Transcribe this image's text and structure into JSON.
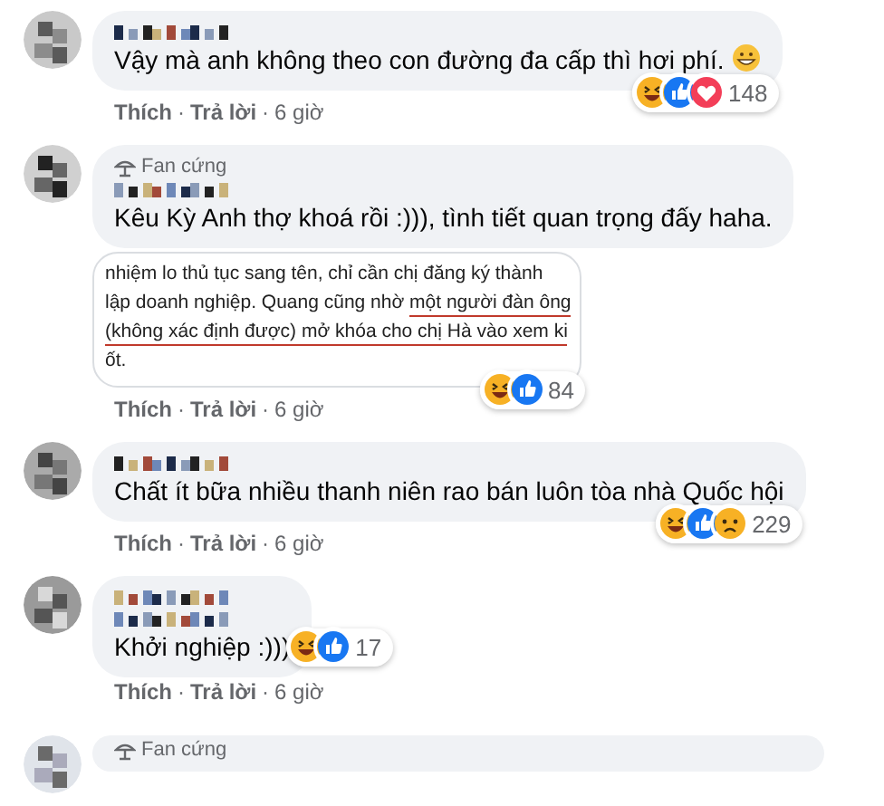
{
  "comments": [
    {
      "text": "Vậy mà anh không theo con đường đa cấp thì hơi phí.",
      "emoji": {
        "kind": "grin"
      },
      "reactions": [
        {
          "kind": "haha"
        },
        {
          "kind": "like"
        },
        {
          "kind": "love"
        }
      ],
      "reaction_count": "148",
      "reactions_inline": false,
      "actions": [
        {
          "kind": "link",
          "text": "Thích"
        },
        {
          "kind": "separator",
          "text": "·"
        },
        {
          "kind": "link",
          "text": "Trả lời"
        },
        {
          "kind": "separator",
          "text": "·"
        },
        {
          "kind": "time",
          "text": "6 giờ"
        }
      ]
    },
    {
      "fan_badge": "Fan cứng",
      "text": "Kêu Kỳ Anh thợ khoá rồi :))), tình tiết quan trọng đấy haha.",
      "attachment": {
        "lines": [
          [
            {
              "text": "nhiệm lo thủ tục sang tên, chỉ cần chị đăng ký thành",
              "underlined": false
            }
          ],
          [
            {
              "text": "lập doanh nghiệp. Quang cũng nhờ ",
              "underlined": false
            },
            {
              "text": "một người đàn ông",
              "underlined": true
            }
          ],
          [
            {
              "text": "(không xác định được) mở khóa cho chị Hà vào xem ki",
              "underlined": true
            }
          ],
          [
            {
              "text": "ốt.",
              "underlined": false
            }
          ]
        ]
      },
      "reactions": [
        {
          "kind": "haha"
        },
        {
          "kind": "like"
        }
      ],
      "reaction_count": "84",
      "reactions_inline": false,
      "actions": [
        {
          "kind": "link",
          "text": "Thích"
        },
        {
          "kind": "separator",
          "text": "·"
        },
        {
          "kind": "link",
          "text": "Trả lời"
        },
        {
          "kind": "separator",
          "text": "·"
        },
        {
          "kind": "time",
          "text": "6 giờ"
        }
      ]
    },
    {
      "text": "Chất ít bữa nhiều thanh niên rao bán luôn tòa nhà Quốc hội",
      "reactions": [
        {
          "kind": "haha"
        },
        {
          "kind": "like"
        },
        {
          "kind": "sad"
        }
      ],
      "reaction_count": "229",
      "reactions_inline": false,
      "actions": [
        {
          "kind": "link",
          "text": "Thích"
        },
        {
          "kind": "separator",
          "text": "·"
        },
        {
          "kind": "link",
          "text": "Trả lời"
        },
        {
          "kind": "separator",
          "text": "·"
        },
        {
          "kind": "time",
          "text": "6 giờ"
        }
      ]
    },
    {
      "double_name": true,
      "text": "Khởi nghiệp :)))",
      "reactions": [
        {
          "kind": "haha"
        },
        {
          "kind": "like"
        }
      ],
      "reaction_count": "17",
      "reactions_inline": true,
      "actions": [
        {
          "kind": "link",
          "text": "Thích"
        },
        {
          "kind": "separator",
          "text": "·"
        },
        {
          "kind": "link",
          "text": "Trả lời"
        },
        {
          "kind": "separator",
          "text": "·"
        },
        {
          "kind": "time",
          "text": "6 giờ"
        }
      ]
    },
    {
      "fan_badge": "Fan cứng",
      "partial": true
    }
  ]
}
